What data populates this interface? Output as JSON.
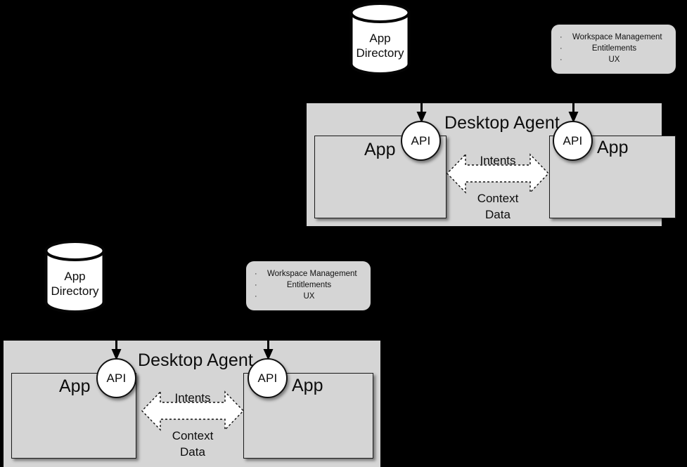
{
  "page": {
    "background_color": "#000000",
    "panel_color": "#d5d5d5",
    "outline_color": "#1a1a1a",
    "circle_fill": "#ffffff"
  },
  "diagrams": [
    {
      "id": "top-right",
      "app_directory": {
        "line1": "App",
        "line2": "Directory"
      },
      "capabilities": {
        "bullet": "·",
        "items": [
          "Workspace Management",
          "Entitlements",
          "UX"
        ]
      },
      "agent": {
        "title": "Desktop Agent"
      },
      "apps": [
        {
          "label": "App",
          "api_label": "API"
        },
        {
          "label": "App",
          "api_label": "API"
        }
      ],
      "flows": {
        "intents": "Intents",
        "context_line1": "Context",
        "context_line2": "Data"
      }
    },
    {
      "id": "bottom-left",
      "app_directory": {
        "line1": "App",
        "line2": "Directory"
      },
      "capabilities": {
        "bullet": "·",
        "items": [
          "Workspace Management",
          "Entitlements",
          "UX"
        ]
      },
      "agent": {
        "title": "Desktop Agent"
      },
      "apps": [
        {
          "label": "App",
          "api_label": "API"
        },
        {
          "label": "App",
          "api_label": "API"
        }
      ],
      "flows": {
        "intents": "Intents",
        "context_line1": "Context",
        "context_line2": "Data"
      }
    }
  ]
}
